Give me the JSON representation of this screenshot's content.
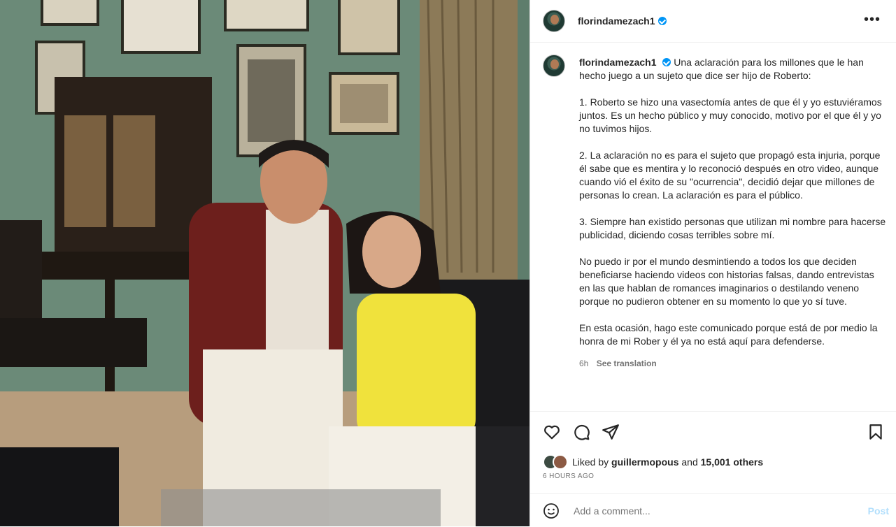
{
  "post": {
    "username": "florindamezach1",
    "caption_paragraphs": [
      "Una aclaración para los millones que le han hecho juego a un sujeto que dice ser hijo de Roberto:",
      "1. Roberto se hizo una vasectomía antes de que él y yo estuviéramos juntos. Es un hecho público y muy conocido, motivo por el que él y yo no tuvimos hijos.",
      "2. La aclaración no es para el sujeto que propagó esta injuria, porque él sabe que es mentira y lo reconoció después en otro video, aunque cuando vió el éxito de su \"ocurrencia\", decidió dejar que millones de personas lo crean. La aclaración es para el público.",
      "3. Siempre han existido personas que utilizan mi nombre para hacerse publicidad, diciendo cosas terribles sobre mí.",
      "No puedo ir por el mundo desmintiendo a todos los que deciden beneficiarse haciendo videos con historias falsas, dando entrevistas en las que hablan de romances imaginarios o destilando veneno porque no pudieron obtener en su momento lo que yo sí tuve.",
      "En esta ocasión, hago este comunicado porque está de por medio la honra de mi Rober y él ya no está aquí para defenderse."
    ],
    "age": "6h",
    "see_translation": "See translation",
    "liked_by_prefix": "Liked by",
    "liked_by_user": "guillermopous",
    "liked_by_and": "and",
    "liked_by_others": "15,001 others",
    "timestamp": "6 HOURS AGO",
    "comment_placeholder": "Add a comment...",
    "post_button": "Post",
    "more_glyph": "•••"
  },
  "icons": [
    "heart-icon",
    "comment-icon",
    "share-icon",
    "bookmark-icon",
    "emoji-icon",
    "verified-icon"
  ],
  "colors": {
    "verified": "#0095f6",
    "post_disabled": "#b2dffc",
    "muted": "#737373"
  }
}
